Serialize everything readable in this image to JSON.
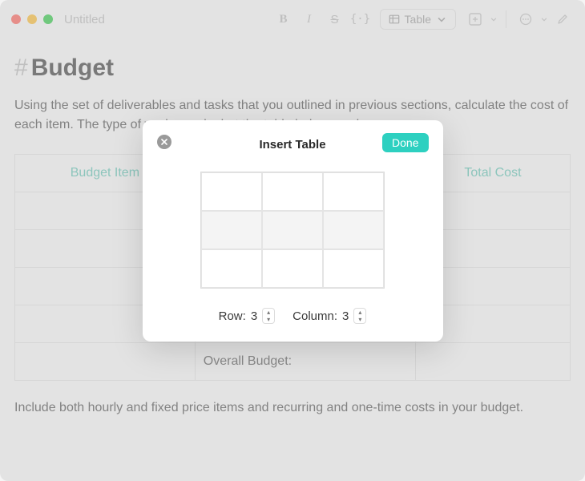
{
  "window": {
    "title": "Untitled"
  },
  "toolbar": {
    "bold": "B",
    "italic": "I",
    "strike": "S",
    "code": "{·}",
    "table_label": "Table"
  },
  "doc": {
    "heading_hash": "#",
    "heading": "Budget",
    "para1": "Using the set of deliverables and tasks that you outlined in previous sections, calculate the cost of each item. The type of work you do, but the table below can b",
    "columns": [
      "Budget Item",
      "",
      "Total Cost"
    ],
    "overall_label": "Overall Budget:",
    "para2": "Include both hourly and fixed price items and recurring and one-time costs in your budget."
  },
  "modal": {
    "title": "Insert Table",
    "done": "Done",
    "row_label": "Row:",
    "row_value": "3",
    "col_label": "Column:",
    "col_value": "3"
  }
}
